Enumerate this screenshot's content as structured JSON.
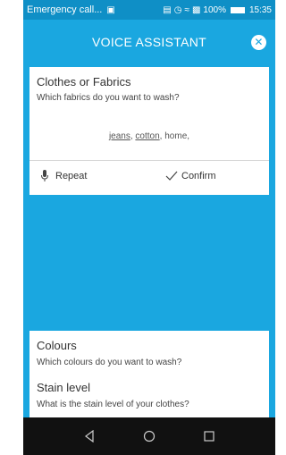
{
  "status_bar": {
    "notification": "Emergency call...",
    "battery_text": "100%",
    "time": "15:35"
  },
  "header": {
    "title": "VOICE ASSISTANT",
    "close_icon": "close-icon"
  },
  "question_card": {
    "title": "Clothes or Fabrics",
    "question": "Which fabrics do you want to wash?",
    "answer_words": [
      "jeans",
      "cotton"
    ],
    "answer_tail": "home,",
    "repeat_label": "Repeat",
    "confirm_label": "Confirm"
  },
  "upcoming": [
    {
      "title": "Colours",
      "question": "Which colours do you want to wash?"
    },
    {
      "title": "Stain level",
      "question": "What is the stain level of your clothes?"
    }
  ],
  "colors": {
    "accent": "#1aa7e0",
    "status_bar": "#0f8fc6",
    "nav_bar": "#111111"
  }
}
